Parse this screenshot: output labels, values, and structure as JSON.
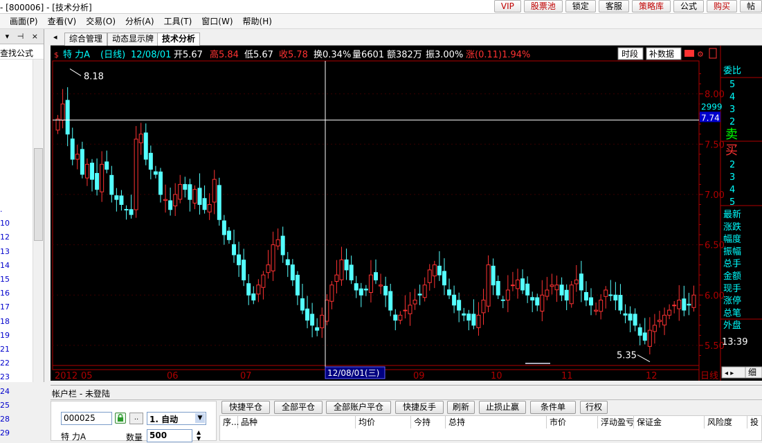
{
  "window": {
    "title": "- [800006] - [技术分析]"
  },
  "top_buttons": [
    {
      "label": "VIP",
      "red": true
    },
    {
      "label": "股票池",
      "red": true
    },
    {
      "label": "锁定",
      "red": false
    },
    {
      "label": "客服",
      "red": false
    },
    {
      "label": "策略库",
      "red": true
    },
    {
      "label": "公式",
      "red": false
    },
    {
      "label": "购买",
      "red": true
    },
    {
      "label": "帖",
      "red": false
    }
  ],
  "menu": [
    "画面(P)",
    "查看(V)",
    "交易(O)",
    "分析(A)",
    "工具(T)",
    "窗口(W)",
    "帮助(H)"
  ],
  "left_panel": {
    "search_label": "查找公式",
    "pin_glyphs": "▾ ⊣ ×",
    "items": [
      ".",
      "10",
      "12",
      "13",
      "14",
      "15",
      "16",
      "17",
      "18",
      "19",
      "21",
      "22",
      "23",
      "24",
      "25",
      "28",
      "29"
    ]
  },
  "tabs": [
    "综合管理",
    "动态显示牌",
    "技术分析"
  ],
  "quote_bar": {
    "name": "特 力A",
    "period": "(日线)",
    "date": "12/08/01",
    "open": "开5.67",
    "high": "高5.84",
    "low": "低5.67",
    "close": "收5.78",
    "turnover": "换0.34%",
    "volume": "量6601",
    "amount": "额382万",
    "amplitude": "振3.00%",
    "change": "涨(0.11)1.94%"
  },
  "chart_buttons": {
    "period": "时段",
    "fill": "补数据"
  },
  "chart_data": {
    "type": "candlestick",
    "y_ticks": [
      "8.00",
      "7.50",
      "7.00",
      "6.50",
      "6.00",
      "5.50"
    ],
    "ylim": [
      5.3,
      8.3
    ],
    "x_labels": [
      "2012",
      "05",
      "06",
      "07",
      "09",
      "10",
      "11",
      "12"
    ],
    "crosshair": {
      "date": "12/08/01(三)",
      "price": "7.74",
      "count": "2999"
    },
    "annotations": {
      "max": "8.18",
      "min": "5.35"
    },
    "period_label": "日线",
    "series_close": [
      7.75,
      7.9,
      7.6,
      7.35,
      7.4,
      7.2,
      7.3,
      7.15,
      7.05,
      7.3,
      7.25,
      7.0,
      6.95,
      6.9,
      6.85,
      6.8,
      7.55,
      7.6,
      7.35,
      7.25,
      7.2,
      7.0,
      6.95,
      6.85,
      7.0,
      7.1,
      7.05,
      6.95,
      7.05,
      6.9,
      6.85,
      6.9,
      7.15,
      6.75,
      6.6,
      6.55,
      6.4,
      6.3,
      6.15,
      6.0,
      5.95,
      6.1,
      6.2,
      6.3,
      6.5,
      6.55,
      6.4,
      6.3,
      6.15,
      6.0,
      5.85,
      5.75,
      5.7,
      5.65,
      5.8,
      5.95,
      6.1,
      6.2,
      6.35,
      6.25,
      6.15,
      6.05,
      6.0,
      6.05,
      6.2,
      6.15,
      6.1,
      6.0,
      5.85,
      5.75,
      5.8,
      5.85,
      5.9,
      5.95,
      6.0,
      6.1,
      6.25,
      6.3,
      6.2,
      6.1,
      6.0,
      5.9,
      5.85,
      5.8,
      5.75,
      5.7,
      5.8,
      5.95,
      6.3,
      6.1,
      6.0,
      5.95,
      6.05,
      6.1,
      6.15,
      6.05,
      6.0,
      5.95,
      5.9,
      6.0,
      6.05,
      6.1,
      6.1,
      6.0,
      5.95,
      6.1,
      6.15,
      6.05,
      5.95,
      5.9,
      5.85,
      5.95,
      6.05,
      6.0,
      5.95,
      5.85,
      5.8,
      5.75,
      5.7,
      5.6,
      5.55,
      5.65,
      5.7,
      5.75,
      5.8,
      5.85,
      5.9,
      5.95,
      5.85,
      5.9,
      6.0
    ]
  },
  "right_panel": {
    "title": "委比",
    "sell_levels": [
      "5",
      "4",
      "3",
      "2"
    ],
    "sell": "卖",
    "buy": "买",
    "buy_levels": [
      "2",
      "3",
      "4",
      "5"
    ],
    "stats": [
      "最新",
      "涨跌",
      "幅度",
      "振幅",
      "总手",
      "金额",
      "现手",
      "涨停",
      "总笔",
      "外盘"
    ],
    "time": "13:39",
    "tab_detail": "细"
  },
  "account": {
    "title": "帐户栏 - 未登陆",
    "code": "000025",
    "mode": "1. 自动",
    "name": "特 力A",
    "qty_label": "数量",
    "qty": "500",
    "buttons": [
      "快捷平仓",
      "全部平仓",
      "全部账户平仓",
      "快捷反手",
      "刷新",
      "止损止赢",
      "条件单",
      "行权"
    ],
    "columns": [
      "序...",
      "品种",
      "均价",
      "今持",
      "总持",
      "市价",
      "浮动盈亏",
      "保证金",
      "风险度",
      "投"
    ]
  },
  "colors": {
    "up": "#ff3232",
    "down": "#54ffff",
    "axis": "#b00000",
    "text": "#ffffff",
    "label_blue": "#00ffff"
  }
}
